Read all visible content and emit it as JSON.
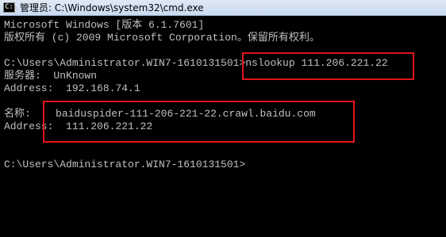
{
  "window": {
    "title": "管理员: C:\\Windows\\system32\\cmd.exe",
    "icon": "cmd-icon",
    "icon_glyph": "C:\\"
  },
  "console": {
    "header_line1": "Microsoft Windows [版本 6.1.7601]",
    "header_line2": "版权所有 (c) 2009 Microsoft Corporation。保留所有权利。",
    "prompt1": "C:\\Users\\Administrator.WIN7-1610131501>",
    "command": "nslookup 111.206.221.22",
    "server_label": "服务器:",
    "server_value": "UnKnown",
    "server_addr_label": "Address:",
    "server_addr_value": "192.168.74.1",
    "name_label": "名称:",
    "name_value": "baiduspider-111-206-221-22.crawl.baidu.com",
    "addr_label": "Address:",
    "addr_value": "111.206.221.22",
    "prompt2": "C:\\Users\\Administrator.WIN7-1610131501>"
  },
  "colors": {
    "console_bg": "#000000",
    "console_text": "#c0c0c0",
    "highlight_border": "#e0141c"
  }
}
